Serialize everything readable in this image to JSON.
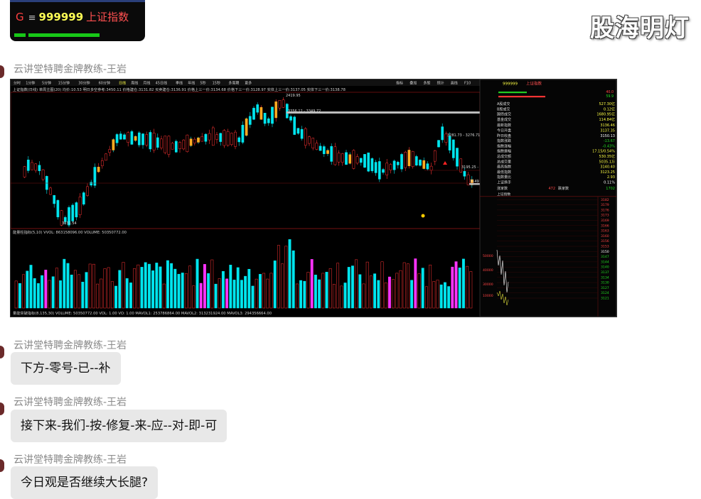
{
  "top_card": {
    "icon": "G",
    "menu": "≡",
    "code": "999999",
    "name": "上证指数"
  },
  "watermark": "股海明灯",
  "messages": [
    {
      "sender": "云讲堂特聘金牌教练-王岩",
      "type": "image"
    },
    {
      "sender": "云讲堂特聘金牌教练-王岩",
      "text": "下方-零号-已--补"
    },
    {
      "sender": "云讲堂特聘金牌教练-王岩",
      "text": "接下来-我们-按-修复-来-应--对-即-可"
    },
    {
      "sender": "云讲堂特聘金牌教练-王岩",
      "text": "今日观是否继续大长腿?"
    }
  ],
  "chart_screenshot": {
    "period_tabs": [
      "分时",
      "1分钟",
      "5分钟",
      "15分钟",
      "30分钟",
      "60分钟",
      "日线",
      "周线",
      "月线",
      "45日线",
      "季线",
      "年线",
      "5秒",
      "15秒",
      "多周期",
      "更多"
    ],
    "active_tab": "日线",
    "toolbar_right": [
      "指标",
      "叠加",
      "多股",
      "统计",
      "画线",
      "F10",
      "自选",
      "返回"
    ],
    "info_line": "上证指数(日线) 单周主图(20) 均价:10.53 明日多空参考:3450.11 价格建仓:3131.82 买卖建仓:3136.91 价格上三一价:3134.68 价格下三一价:3128.97 实体上三一价:3137.05 实体下三一价:3138.78",
    "price_labels": [
      "2419.95",
      "3356.12 - 3349.72",
      "3281.73 - 3276.71",
      "3195.25 -",
      "3031.54",
      "3149",
      "3316.1"
    ],
    "volume_title": "能量柱指标(5,10) VVOL: 863158096.00  VOLUME: 50350772.00",
    "bottom_bar": "量能突破指标(8,135,30) VOLUME: 50350772.00  VOL: 1.00  VO: 1.00  MAVOL1: 253786864.00  MAVOL2: 313231924.00  MAVOL3: 294356664.00",
    "axis_labels": [
      "50000",
      "40000",
      "30000",
      "10000"
    ],
    "side_header": {
      "code": "999999",
      "name": "上证指数"
    },
    "side_pct": [
      "40.0",
      "59.9"
    ],
    "side_rows": [
      {
        "label": "A股成交",
        "value": "527.30亿"
      },
      {
        "label": "B股成交",
        "value": "0.12亿"
      },
      {
        "label": "国债成交",
        "value": "1680.95亿"
      },
      {
        "label": "基金成交",
        "value": "114.84亿"
      },
      {
        "label": "最新指数",
        "value": "3136.46"
      },
      {
        "label": "今日开盘",
        "value": "3137.35"
      },
      {
        "label": "昨日收盘",
        "value": "3150.13"
      },
      {
        "label": "指数涨跌",
        "value": "-13.67"
      },
      {
        "label": "指数涨幅",
        "value": "-0.43%"
      },
      {
        "label": "指数振幅",
        "value": "17.15/0.54%"
      },
      {
        "label": "总成交额",
        "value": "530.35亿"
      },
      {
        "label": "总成交量",
        "value": "5035.1万"
      },
      {
        "label": "最高指数",
        "value": "3140.40"
      },
      {
        "label": "最低指数",
        "value": "3123.25"
      },
      {
        "label": "指数量比",
        "value": "2.93"
      },
      {
        "label": "上证换手",
        "value": "0.11%"
      }
    ],
    "up_label": "涨家数",
    "up_value": "472",
    "down_label": "跌家数",
    "down_value": "1702",
    "mini_title": "上证指数",
    "mini_axis": [
      "3182",
      "3179",
      "3176",
      "3173",
      "3169",
      "3166",
      "3163",
      "3160",
      "3156",
      "3153",
      "3150",
      "3147",
      "3144",
      "3140",
      "3137",
      "3134",
      "3130",
      "3127",
      "3124",
      "3121"
    ],
    "mini_left_axis": [
      "50000",
      "40000",
      "30000",
      "10000"
    ]
  }
}
